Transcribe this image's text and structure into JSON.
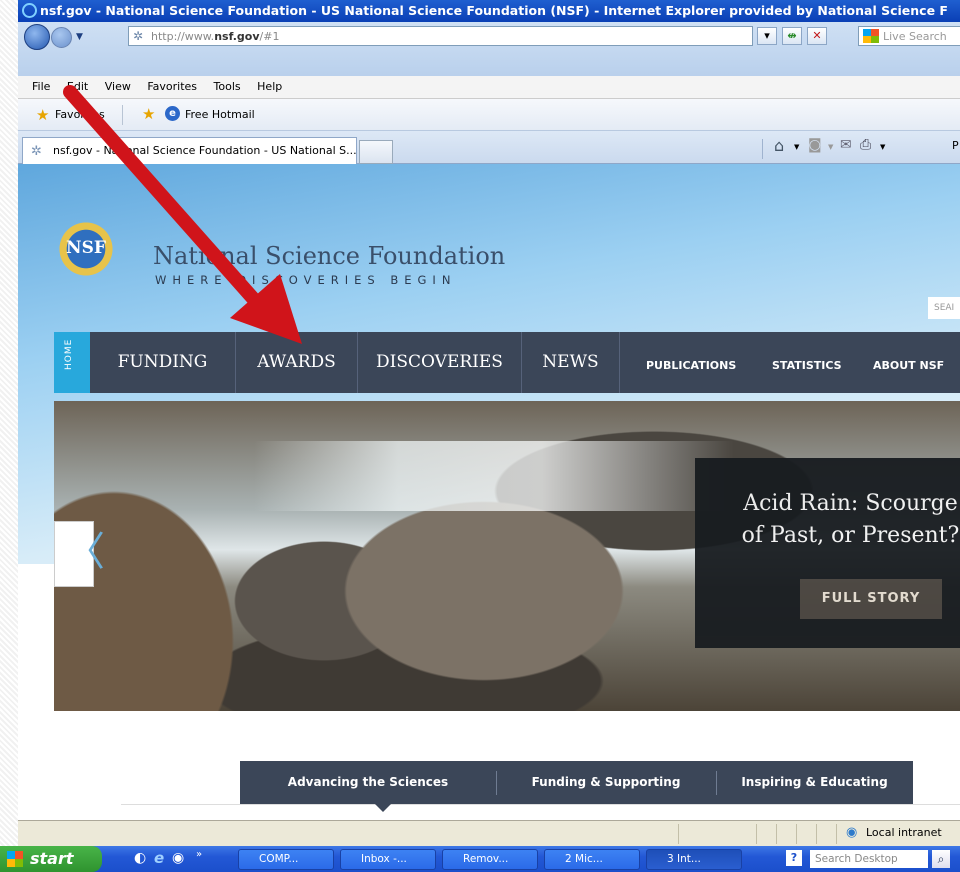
{
  "window": {
    "title": "nsf.gov - National Science Foundation - US National Science Foundation (NSF) - Internet Explorer provided by National Science F"
  },
  "address_bar": {
    "url_prefix": "http://www.",
    "url_domain": "nsf.gov",
    "url_suffix": "/#1",
    "search_placeholder": "Live Search"
  },
  "menu": [
    "File",
    "Edit",
    "View",
    "Favorites",
    "Tools",
    "Help"
  ],
  "favorites_bar": {
    "favorites_label": "Favorites",
    "link1": "Free Hotmail"
  },
  "tab": {
    "label": "nsf.gov - National Science Foundation - US National S..."
  },
  "command_bar": {
    "page_label": "P"
  },
  "site": {
    "seal_text": "NSF",
    "org_name": "National Science Foundation",
    "tagline": "WHERE DISCOVERIES BEGIN",
    "search_stub": "SEAI",
    "nav": {
      "home": "HOME",
      "primary": [
        "FUNDING",
        "AWARDS",
        "DISCOVERIES",
        "NEWS"
      ],
      "secondary": [
        "PUBLICATIONS",
        "STATISTICS",
        "ABOUT NSF"
      ]
    },
    "hero": {
      "title_line1": "Acid Rain: Scourge",
      "title_line2": "of Past, or Present?",
      "button": "FULL STORY",
      "prev_glyph": "〈"
    },
    "section_tabs": [
      "Advancing the Sciences",
      "Funding & Supporting",
      "Inspiring & Educating"
    ]
  },
  "status_bar": {
    "zone": "Local intranet"
  },
  "taskbar": {
    "start": "start",
    "tasks": [
      "COMP...",
      "Inbox -...",
      "Remov...",
      "2 Mic...",
      "3 Int..."
    ],
    "search_placeholder": "Search Desktop"
  },
  "colors": {
    "annotation_arrow": "#d0141a",
    "nav_background": "#3b4658",
    "home_tab": "#28a8dc"
  }
}
